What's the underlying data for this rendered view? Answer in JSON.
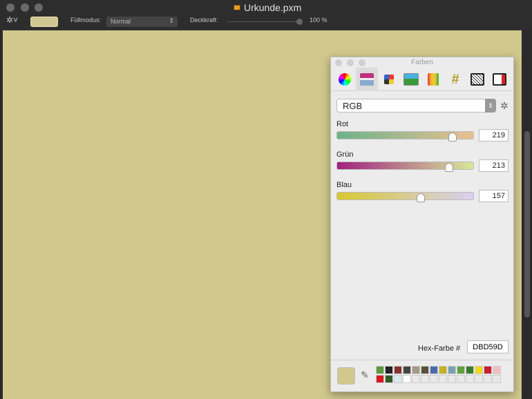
{
  "window": {
    "title": "Urkunde.pxm"
  },
  "toolbar": {
    "fill_mode_label": "Füllmodus:",
    "fill_mode_value": "Normal",
    "opacity_label": "Deckkraft:",
    "opacity_value": "100 %",
    "opacity_fraction": 1.0,
    "fill_color": "#d0c890"
  },
  "color_panel": {
    "title": "Farben",
    "tabs": [
      "color-wheel",
      "color-sliders",
      "color-palettes",
      "image-palettes",
      "crayons",
      "hex-palette",
      "web-palette",
      "custom-palette"
    ],
    "active_tab": 1,
    "mode": "RGB",
    "sliders": [
      {
        "label": "Rot",
        "value": "219",
        "fraction": 0.859
      },
      {
        "label": "Grün",
        "value": "213",
        "fraction": 0.835
      },
      {
        "label": "Blau",
        "value": "157",
        "fraction": 0.616
      }
    ],
    "hex_label": "Hex-Farbe #",
    "hex_value": "DBD59D",
    "current_color": "#d1c88d",
    "swatches": [
      "#5a9a3a",
      "#222222",
      "#8a3030",
      "#444444",
      "#a09a88",
      "#5a5038",
      "#4a6ab0",
      "#c8b020",
      "#7aa0b0",
      "#60a040",
      "#3a7a30",
      "#f0d820",
      "#c82030",
      "#f0c0c0",
      "#d81820",
      "#305a28",
      "#d8e8f0",
      "#ffffff",
      "",
      "",
      "",
      "",
      "",
      "",
      "",
      "",
      "",
      ""
    ]
  }
}
